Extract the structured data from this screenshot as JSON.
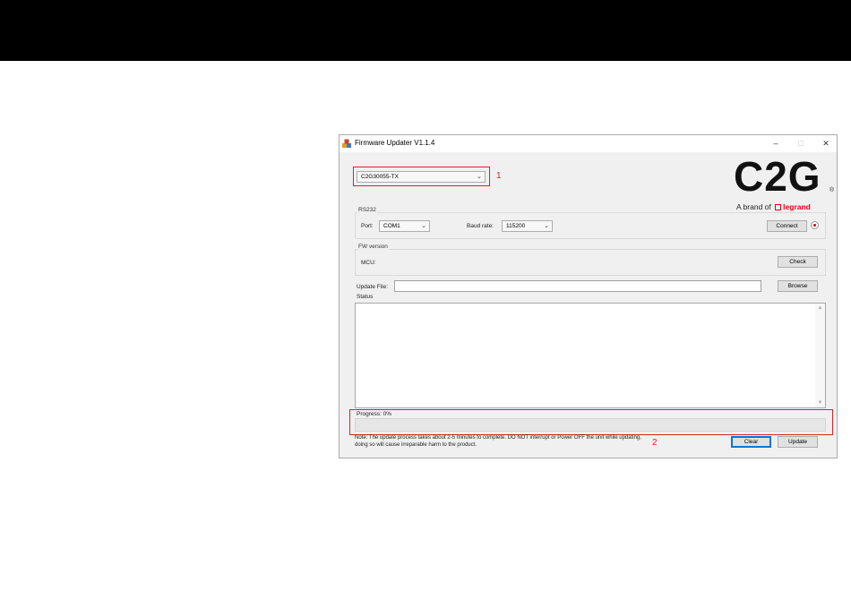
{
  "window": {
    "title": "Firmware Updater V1.1.4",
    "minimize": "–",
    "maximize": "□",
    "close": "✕"
  },
  "model_select": {
    "value": "C2G30055-TX",
    "arrow": "⌄"
  },
  "annotations": {
    "box1_number": "1",
    "box2_number": "2",
    "color": "#e02020"
  },
  "logo": {
    "text": "C2G",
    "registered": "®",
    "brand_prefix": "A brand of",
    "brand_name": "legrand"
  },
  "rs232": {
    "group_label": "RS232",
    "port_label": "Port:",
    "port_value": "COM1",
    "baud_label": "Baud rate:",
    "baud_value": "115200",
    "connect_label": "Connect",
    "status_led_color": "#cc0000"
  },
  "fw_version": {
    "group_label": "FW version",
    "mcu_label": "MCU:",
    "check_label": "Check"
  },
  "update_file": {
    "label": "Update File:",
    "value": "",
    "browse_label": "Browse"
  },
  "status": {
    "label": "Status",
    "text": ""
  },
  "progress": {
    "label": "Progress: 0%",
    "value": 0
  },
  "note": "Note: The update process takes about 2-5 minutes to complete. DO NOT interrupt or Power OFF the unit while updating, doing so will cause irreparable harm to the product.",
  "buttons": {
    "clear": "Clear",
    "update": "Update"
  }
}
